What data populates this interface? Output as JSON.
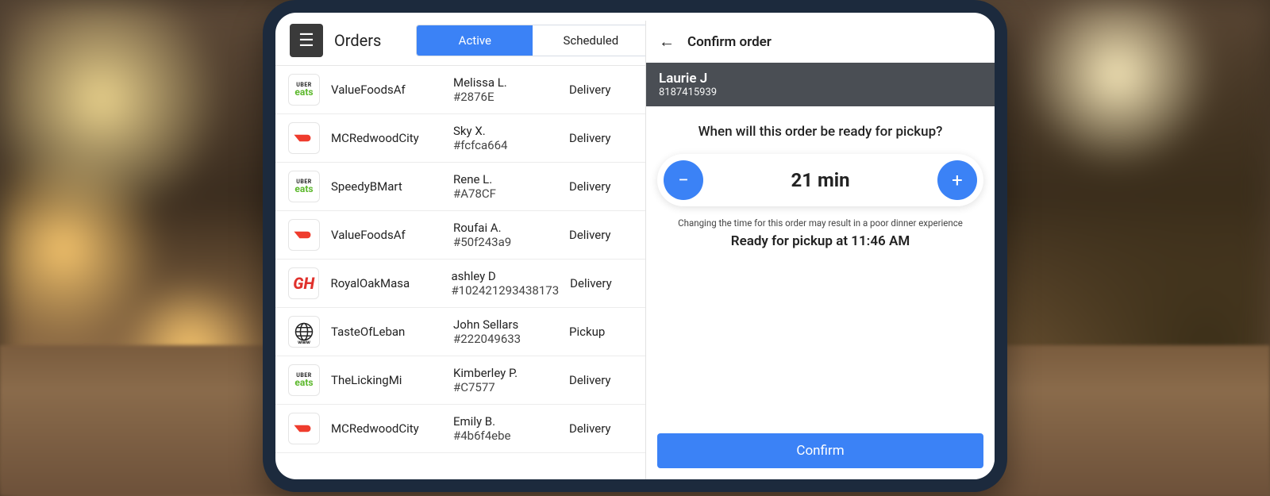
{
  "header": {
    "title": "Orders",
    "tabs": {
      "active": "Active",
      "scheduled": "Scheduled"
    }
  },
  "orders": [
    {
      "brand": "ubereats",
      "restaurant": "ValueFoodsAf",
      "customer": "Melissa L.",
      "order_id": "#2876E",
      "type": "Delivery"
    },
    {
      "brand": "doordash",
      "restaurant": "MCRedwoodCity",
      "customer": "Sky X.",
      "order_id": "#fcfca664",
      "type": "Delivery"
    },
    {
      "brand": "ubereats",
      "restaurant": "SpeedyBMart",
      "customer": "Rene L.",
      "order_id": "#A78CF",
      "type": "Delivery"
    },
    {
      "brand": "doordash",
      "restaurant": "ValueFoodsAf",
      "customer": "Roufai A.",
      "order_id": "#50f243a9",
      "type": "Delivery"
    },
    {
      "brand": "grubhub",
      "restaurant": "RoyalOakMasa",
      "customer": "ashley D",
      "order_id": "#102421293438173",
      "type": "Delivery"
    },
    {
      "brand": "web",
      "restaurant": "TasteOfLeban",
      "customer": "John Sellars",
      "order_id": "#222049633",
      "type": "Pickup"
    },
    {
      "brand": "ubereats",
      "restaurant": "TheLickingMi",
      "customer": "Kimberley P.",
      "order_id": "#C7577",
      "type": "Delivery"
    },
    {
      "brand": "doordash",
      "restaurant": "MCRedwoodCity",
      "customer": "Emily B.",
      "order_id": "#4b6f4ebe",
      "type": "Delivery"
    }
  ],
  "detail": {
    "title": "Confirm order",
    "customer_name": "Laurie J",
    "customer_phone": "8187415939",
    "question": "When will this order be ready for pickup?",
    "time_display": "21 min",
    "warning": "Changing the time for this order may result in a poor dinner experience",
    "ready_text": "Ready for pickup at 11:46 AM",
    "confirm_label": "Confirm"
  }
}
